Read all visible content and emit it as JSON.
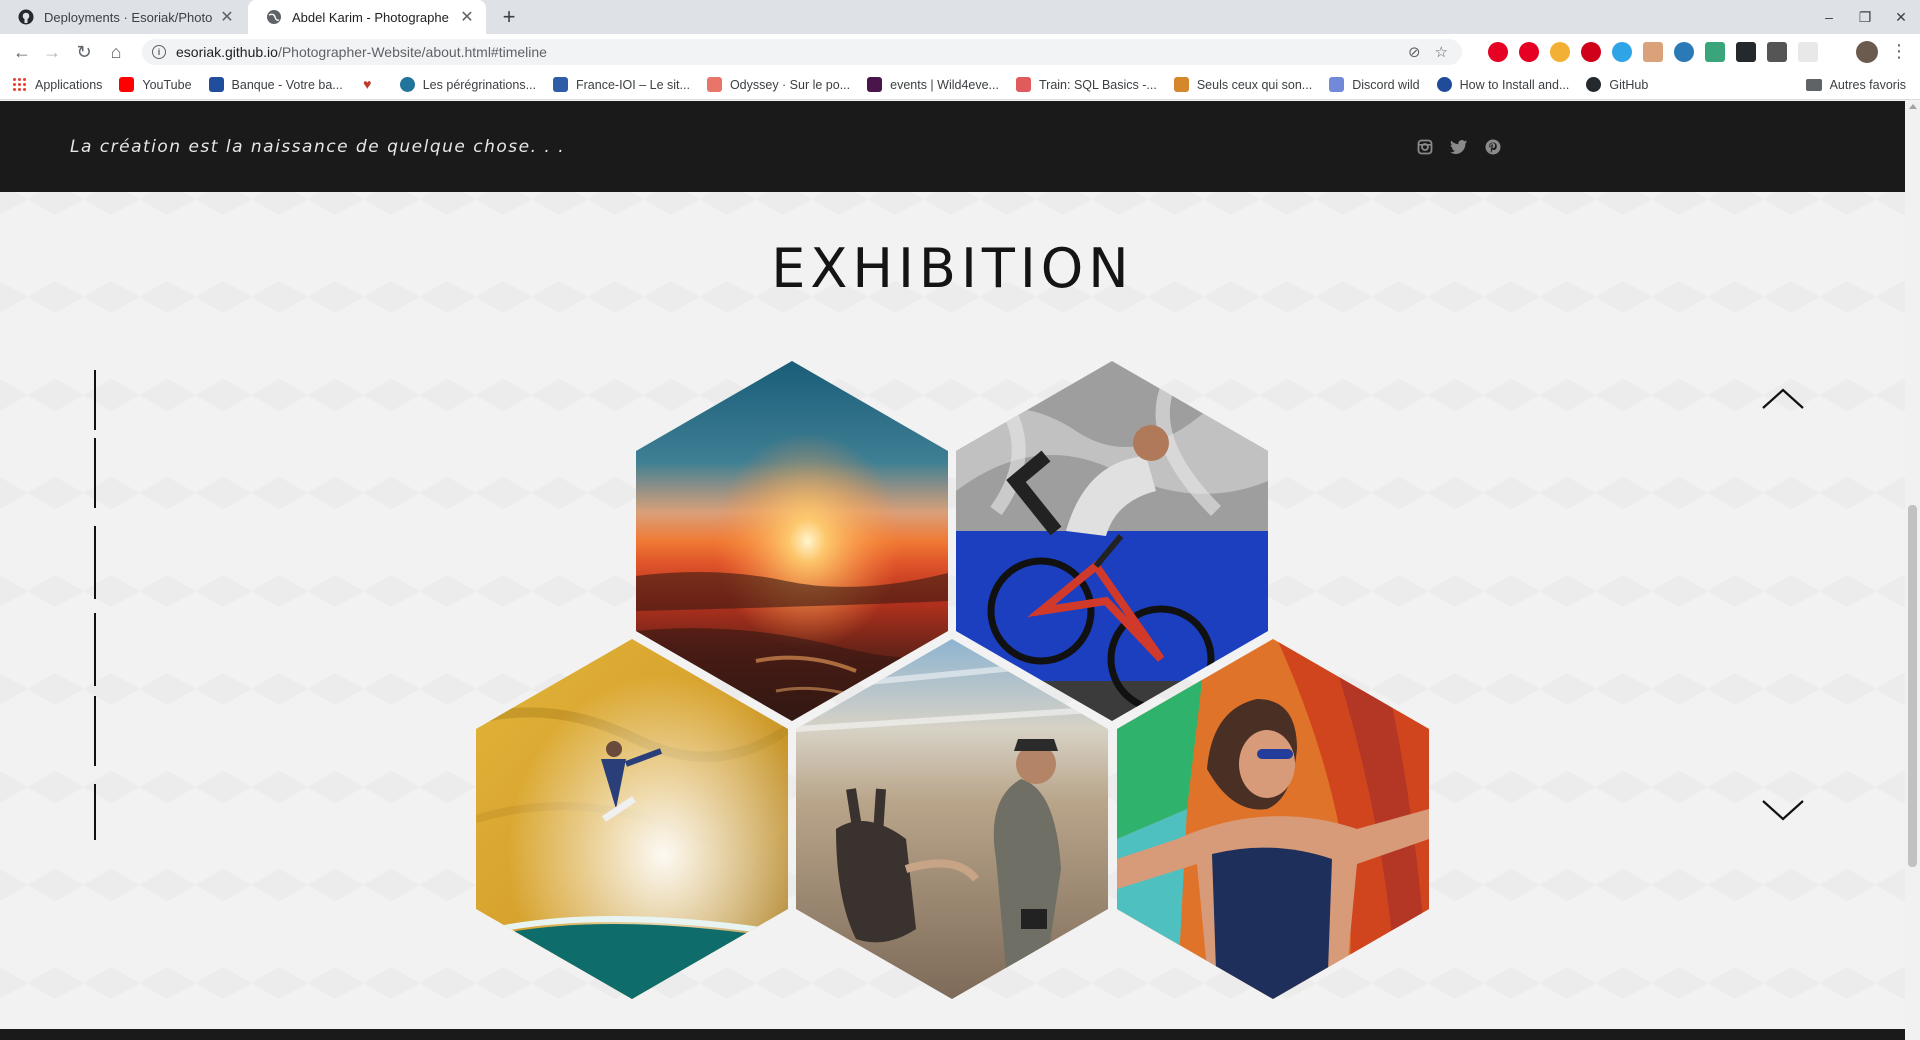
{
  "browser": {
    "tabs": [
      {
        "title": "Deployments · Esoriak/Photogr",
        "active": false,
        "icon": "github-icon"
      },
      {
        "title": "Abdel Karim - Photographe",
        "active": true,
        "icon": "globe-icon"
      }
    ],
    "url_host": "esoriak.github.io",
    "url_path": "/Photographer-Website/about.html#timeline",
    "bookmarks": [
      {
        "label": "Applications",
        "color": "#4285f4"
      },
      {
        "label": "YouTube",
        "color": "#ff0000"
      },
      {
        "label": "Banque - Votre ba...",
        "color": "#1e4e9c"
      },
      {
        "label": "",
        "color": "#c0392b"
      },
      {
        "label": "Les pérégrinations...",
        "color": "#21759b"
      },
      {
        "label": "France-IOI – Le sit...",
        "color": "#2e5da8"
      },
      {
        "label": "Odyssey · Sur le po...",
        "color": "#e8756a"
      },
      {
        "label": "events | Wild4eve...",
        "color": "#4a154b"
      },
      {
        "label": "Train: SQL Basics -...",
        "color": "#e05c5c"
      },
      {
        "label": "Seuls ceux qui son...",
        "color": "#d4882b"
      },
      {
        "label": "Discord wild",
        "color": "#7289da"
      },
      {
        "label": "How to Install and...",
        "color": "#1f4b99"
      },
      {
        "label": "GitHub",
        "color": "#24292e"
      }
    ],
    "other_bookmarks": "Autres favoris"
  },
  "hero": {
    "tagline": "La création est la naissance de quelque chose. . .",
    "socials": [
      "instagram-icon",
      "twitter-icon",
      "pinterest-icon"
    ]
  },
  "section": {
    "title": "EXHIBITION"
  },
  "gallery": [
    {
      "name": "sunset-photo",
      "subject": "Sunset over the sea"
    },
    {
      "name": "bmx-rider-photo",
      "subject": "Cyclist against a blue wall"
    },
    {
      "name": "surfer-photo",
      "subject": "Surfer on a wave"
    },
    {
      "name": "donkey-photo",
      "subject": "Man petting a donkey"
    },
    {
      "name": "woman-smiling-photo",
      "subject": "Smiling woman in front of a colorful wall"
    }
  ],
  "colors": {
    "dark_band": "#1a1a1a",
    "page_bg": "#f2f2f2",
    "title": "#141414"
  }
}
